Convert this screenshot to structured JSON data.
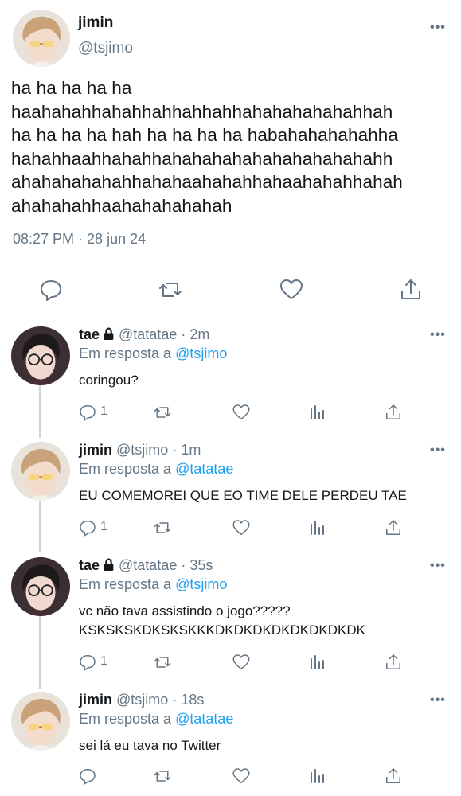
{
  "main_tweet": {
    "name": "jimin",
    "handle": "@tsjimo",
    "text": "ha ha ha ha ha\nhaahahahhahahhahhahhahhahahahahahahhah\nha ha ha ha hah ha ha ha ha habahahahahahha\nhahahhaahhahahhahahahahahahahahahahahh\nahahahahahahhahahaahahahhahaahahahhahah\nahahahahhaahahahahahah",
    "timestamp": "08:27 PM · 28 jun 24",
    "more_icon": "more-dots-icon",
    "actions": [
      "reply-icon",
      "retweet-icon",
      "like-icon",
      "share-icon"
    ]
  },
  "replies": [
    {
      "name": "tae",
      "locked": true,
      "handle": "@tatatae",
      "time": "· 2m",
      "in_reply_prefix": "Em resposta a",
      "in_reply_to": "@tsjimo",
      "text": "coringou?",
      "reply_count": "1"
    },
    {
      "name": "jimin",
      "locked": false,
      "handle": "@tsjimo",
      "time": "· 1m",
      "in_reply_prefix": "Em resposta a",
      "in_reply_to": "@tatatae",
      "text": "EU COMEMOREI QUE EO TIME DELE PERDEU TAE",
      "reply_count": "1"
    },
    {
      "name": "tae",
      "locked": true,
      "handle": "@tatatae",
      "time": "· 35s",
      "in_reply_prefix": "Em resposta a",
      "in_reply_to": "@tsjimo",
      "text": "vc não tava assistindo o jogo?????\nKSKSKSKDKSKSKKKDKDKDKDKDKDKDKDK",
      "reply_count": "1"
    },
    {
      "name": "jimin",
      "locked": false,
      "handle": "@tsjimo",
      "time": "· 18s",
      "in_reply_prefix": "Em resposta a",
      "in_reply_to": "@tatatae",
      "text": "sei lá eu tava no Twitter",
      "reply_count": ""
    }
  ],
  "colors": {
    "text": "#14171a",
    "secondary": "#657786",
    "link": "#1da1f2",
    "divider": "#e1e8ed",
    "thread_line": "#ccd6dd"
  }
}
